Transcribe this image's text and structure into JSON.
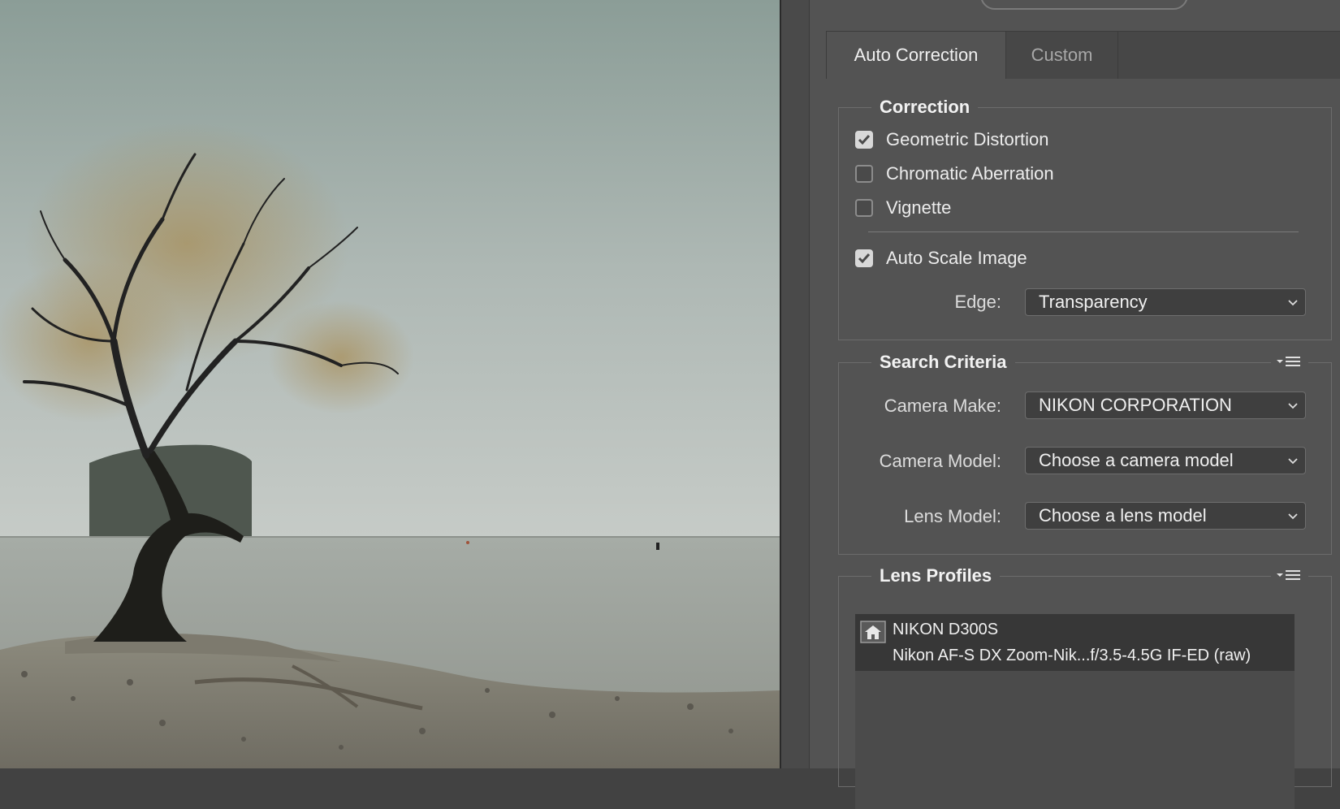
{
  "tabs": {
    "auto_correction": "Auto Correction",
    "custom": "Custom"
  },
  "correction": {
    "title": "Correction",
    "options": [
      {
        "label": "Geometric Distortion",
        "checked": true
      },
      {
        "label": "Chromatic Aberration",
        "checked": false
      },
      {
        "label": "Vignette",
        "checked": false
      }
    ],
    "auto_scale": {
      "label": "Auto Scale Image",
      "checked": true
    },
    "edge": {
      "label": "Edge:",
      "value": "Transparency"
    }
  },
  "search_criteria": {
    "title": "Search Criteria",
    "camera_make": {
      "label": "Camera Make:",
      "value": "NIKON CORPORATION"
    },
    "camera_model": {
      "label": "Camera Model:",
      "value": "Choose a camera model"
    },
    "lens_model": {
      "label": "Lens Model:",
      "value": "Choose a lens model"
    }
  },
  "lens_profiles": {
    "title": "Lens Profiles",
    "items": [
      {
        "camera": "NIKON D300S",
        "lens": "Nikon AF-S DX Zoom-Nik...f/3.5-4.5G IF-ED (raw)",
        "icon": "home-icon"
      }
    ]
  },
  "colors": {
    "panel_bg": "#535353",
    "tab_bar_bg": "#474747",
    "selected_profile_bg": "#373737"
  }
}
